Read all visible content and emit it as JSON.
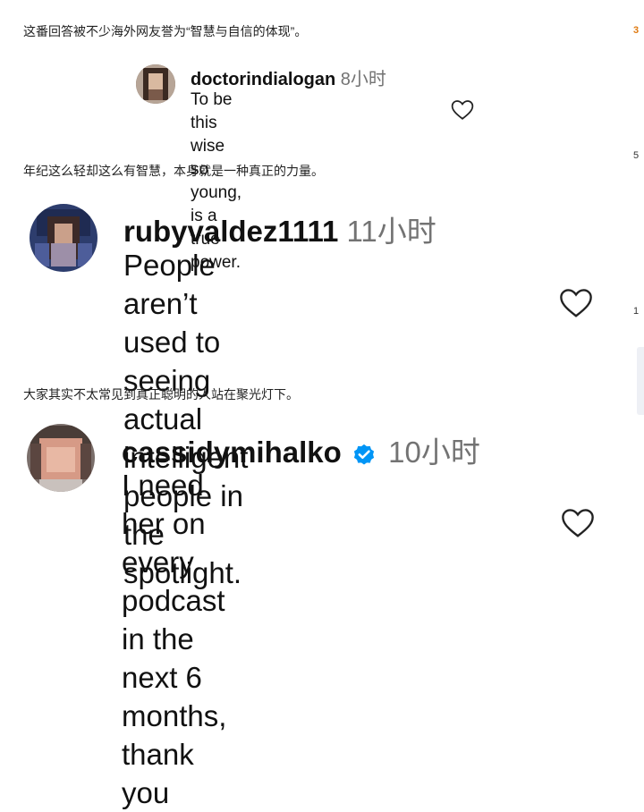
{
  "captions": {
    "c1": "这番回答被不少海外网友誉为“智慧与自信的体现”。",
    "c2": "年纪这么轻却这么有智慧，本身就是一种真正的力量。",
    "c3": "大家其实不太常见到真正聪明的人站在聚光灯下。"
  },
  "comments": [
    {
      "username": "doctorindialogan",
      "time": "8小时",
      "line1": "To be this wise so young, is a",
      "line2": "true power."
    },
    {
      "username": "rubyvaldez1111",
      "time": "11小时",
      "line1": "People aren’t used to seeing",
      "line2": "actual intelligent people in",
      "line3": "the spotlight."
    },
    {
      "username": "cassidymihalko",
      "time": "10小时",
      "line1": "I need her on every podcast",
      "line2": "in the next 6 months, thank",
      "line3": "you",
      "verified": true
    }
  ],
  "icons": {
    "heart": "heart-outline-icon",
    "verified": "verified-badge-icon"
  },
  "colors": {
    "text": "#111111",
    "muted": "#737373",
    "verified": "#0095f6",
    "orange": "#e07a10"
  },
  "right_fragments": {
    "r1": "3",
    "r2": "1",
    "r3": "5"
  }
}
